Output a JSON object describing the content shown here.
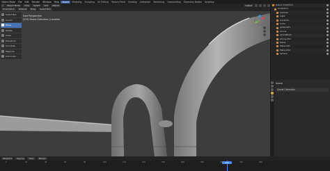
{
  "menu": [
    "Object Mode",
    "File",
    "Edit",
    "Render",
    "Window",
    "Help"
  ],
  "workspaces": [
    "Layout",
    "Modeling",
    "Sculpting",
    "UV Editing",
    "Texture Paint",
    "Shading",
    "Animation",
    "Rendering",
    "Compositing",
    "Geometry Nodes",
    "Scripting"
  ],
  "active_workspace": "Layout",
  "header": {
    "mode": "Object Mode",
    "view": "View",
    "select": "Select",
    "add": "Add",
    "object": "Object",
    "orientation": "Global"
  },
  "subheader": {
    "orientation": "Orientation",
    "default": "Default",
    "drag": "Drag",
    "select_box": "Select Box"
  },
  "viewport_info": {
    "line1": "User Perspective",
    "line2": "(213) Scene Collection | Lunamia"
  },
  "toolbar": [
    "Select Box",
    "Cursor",
    "Move",
    "Rotate",
    "Scale",
    "Transform",
    "Annotate",
    "Measure",
    "Add Cube"
  ],
  "active_tool": "Move",
  "outliner": {
    "rows": [
      "Scene Collection",
      "Collection",
      "Camera",
      "Light",
      "Lunamia",
      "Cube",
      "globe.001",
      "phone",
      "phoneBody",
      "phone.001",
      "Plane",
      "Plane.001",
      "Plane.002",
      "Sphere"
    ]
  },
  "properties": {
    "title": "Scene",
    "section": "Scene Collection"
  },
  "timeline": {
    "menu": [
      "Playback",
      "Keying",
      "View",
      "Marker"
    ],
    "ticks": [
      "0",
      "20",
      "40",
      "60",
      "80",
      "100",
      "120",
      "140",
      "160",
      "180",
      "200",
      "220",
      "240",
      "260"
    ],
    "current_frame": "213"
  },
  "colors": {
    "accent": "#4772b3",
    "playhead": "#4b8bf5",
    "viewport": "#3d3d3d"
  }
}
